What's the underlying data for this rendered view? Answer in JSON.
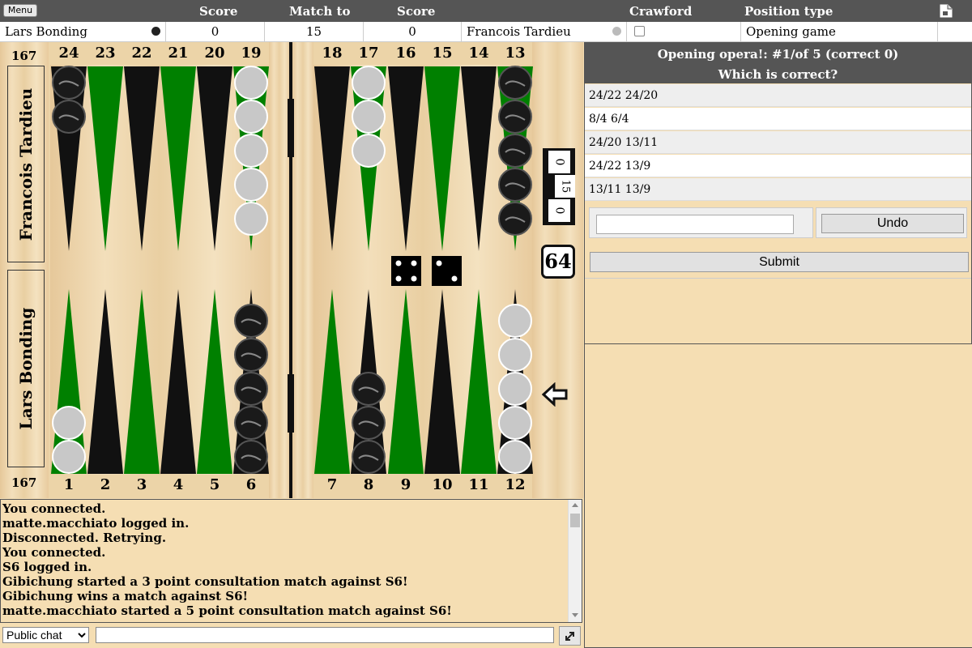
{
  "header": {
    "menu_label": "Menu",
    "col_score1": "Score",
    "col_match_to": "Match to",
    "col_score2": "Score",
    "col_crawford": "Crawford",
    "col_position_type": "Position type",
    "doc_icon": "document-icon"
  },
  "match": {
    "player1": "Lars Bonding",
    "player1_score": "0",
    "match_to": "15",
    "player2_score": "0",
    "player2": "Francois Tardieu",
    "crawford_checked": false,
    "position_type": "Opening game"
  },
  "board": {
    "top_points": [
      "24",
      "23",
      "22",
      "21",
      "20",
      "19",
      "18",
      "17",
      "16",
      "15",
      "14",
      "13"
    ],
    "bottom_points": [
      "1",
      "2",
      "3",
      "4",
      "5",
      "6",
      "7",
      "8",
      "9",
      "10",
      "11",
      "12"
    ],
    "pip_top": "167",
    "pip_bottom": "167",
    "top_player": "Francois Tardieu",
    "bottom_player": "Lars Bonding",
    "score_strip": [
      "0",
      "15",
      "0"
    ],
    "cube_value": "64",
    "dice": [
      4,
      2
    ],
    "colors": {
      "green": "#008000",
      "black": "#111111",
      "white_checker": "#c8c8c8",
      "dark_checker": "#1a1a1a"
    },
    "arrow_icon": "left-arrow-icon"
  },
  "quiz": {
    "title": "Opening opera!: #1/of 5 (correct 0)",
    "question": "Which is correct?",
    "options": [
      "24/22 24/20",
      "8/4 6/4",
      "24/20 13/11",
      "24/22 13/9",
      "13/11 13/9"
    ],
    "input_value": "",
    "undo_label": "Undo",
    "submit_label": "Submit"
  },
  "chat": {
    "lines": [
      "You connected.",
      "matte.macchiato logged in.",
      "Disconnected. Retrying.",
      "You connected.",
      "S6 logged in.",
      "Gibichung started a 3 point consultation match against S6!",
      "Gibichung wins a match against S6!",
      "matte.macchiato started a 5 point consultation match against S6!"
    ],
    "channel": "Public chat",
    "channel_options": [
      "Public chat"
    ],
    "input_value": "",
    "expand_icon": "expand-icon"
  }
}
